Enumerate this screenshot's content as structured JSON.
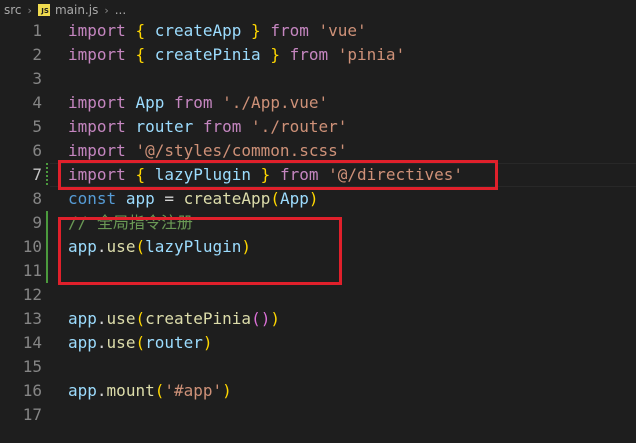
{
  "breadcrumb": {
    "folder": "src",
    "file_badge": "JS",
    "file": "main.js",
    "ellipsis": "..."
  },
  "editor": {
    "line_numbers": [
      "1",
      "2",
      "3",
      "4",
      "5",
      "6",
      "7",
      "8",
      "9",
      "10",
      "11",
      "12",
      "13",
      "14",
      "15",
      "16",
      "17"
    ],
    "active_line": "7",
    "lines": [
      [
        {
          "t": "import",
          "c": "kw2"
        },
        {
          "t": " ",
          "c": "plain"
        },
        {
          "t": "{",
          "c": "b1"
        },
        {
          "t": " createApp ",
          "c": "var"
        },
        {
          "t": "}",
          "c": "b1"
        },
        {
          "t": " ",
          "c": "plain"
        },
        {
          "t": "from",
          "c": "kw2"
        },
        {
          "t": " ",
          "c": "plain"
        },
        {
          "t": "'vue'",
          "c": "str"
        }
      ],
      [
        {
          "t": "import",
          "c": "kw2"
        },
        {
          "t": " ",
          "c": "plain"
        },
        {
          "t": "{",
          "c": "b1"
        },
        {
          "t": " createPinia ",
          "c": "var"
        },
        {
          "t": "}",
          "c": "b1"
        },
        {
          "t": " ",
          "c": "plain"
        },
        {
          "t": "from",
          "c": "kw2"
        },
        {
          "t": " ",
          "c": "plain"
        },
        {
          "t": "'pinia'",
          "c": "str"
        }
      ],
      [],
      [
        {
          "t": "import",
          "c": "kw2"
        },
        {
          "t": " ",
          "c": "plain"
        },
        {
          "t": "App",
          "c": "var"
        },
        {
          "t": " ",
          "c": "plain"
        },
        {
          "t": "from",
          "c": "kw2"
        },
        {
          "t": " ",
          "c": "plain"
        },
        {
          "t": "'./App.vue'",
          "c": "str"
        }
      ],
      [
        {
          "t": "import",
          "c": "kw2"
        },
        {
          "t": " ",
          "c": "plain"
        },
        {
          "t": "router",
          "c": "var"
        },
        {
          "t": " ",
          "c": "plain"
        },
        {
          "t": "from",
          "c": "kw2"
        },
        {
          "t": " ",
          "c": "plain"
        },
        {
          "t": "'./router'",
          "c": "str"
        }
      ],
      [
        {
          "t": "import",
          "c": "kw2"
        },
        {
          "t": " ",
          "c": "plain"
        },
        {
          "t": "'@/styles/common.scss'",
          "c": "str"
        }
      ],
      [
        {
          "t": "import",
          "c": "kw2"
        },
        {
          "t": " ",
          "c": "plain"
        },
        {
          "t": "{",
          "c": "b1"
        },
        {
          "t": " lazyPlugin ",
          "c": "var"
        },
        {
          "t": "}",
          "c": "b1"
        },
        {
          "t": " ",
          "c": "plain"
        },
        {
          "t": "from",
          "c": "kw2"
        },
        {
          "t": " ",
          "c": "plain"
        },
        {
          "t": "'@/directives'",
          "c": "str"
        }
      ],
      [
        {
          "t": "const",
          "c": "kw"
        },
        {
          "t": " ",
          "c": "plain"
        },
        {
          "t": "app",
          "c": "var"
        },
        {
          "t": " = ",
          "c": "plain"
        },
        {
          "t": "createApp",
          "c": "fn"
        },
        {
          "t": "(",
          "c": "b1"
        },
        {
          "t": "App",
          "c": "var"
        },
        {
          "t": ")",
          "c": "b1"
        }
      ],
      [
        {
          "t": "// 全局指令注册",
          "c": "cmt"
        }
      ],
      [
        {
          "t": "app",
          "c": "var"
        },
        {
          "t": ".",
          "c": "plain"
        },
        {
          "t": "use",
          "c": "fn"
        },
        {
          "t": "(",
          "c": "b1"
        },
        {
          "t": "lazyPlugin",
          "c": "var"
        },
        {
          "t": ")",
          "c": "b1"
        }
      ],
      [],
      [],
      [
        {
          "t": "app",
          "c": "var"
        },
        {
          "t": ".",
          "c": "plain"
        },
        {
          "t": "use",
          "c": "fn"
        },
        {
          "t": "(",
          "c": "b1"
        },
        {
          "t": "createPinia",
          "c": "fn"
        },
        {
          "t": "(",
          "c": "b2"
        },
        {
          "t": ")",
          "c": "b2"
        },
        {
          "t": ")",
          "c": "b1"
        }
      ],
      [
        {
          "t": "app",
          "c": "var"
        },
        {
          "t": ".",
          "c": "plain"
        },
        {
          "t": "use",
          "c": "fn"
        },
        {
          "t": "(",
          "c": "b1"
        },
        {
          "t": "router",
          "c": "var"
        },
        {
          "t": ")",
          "c": "b1"
        }
      ],
      [],
      [
        {
          "t": "app",
          "c": "var"
        },
        {
          "t": ".",
          "c": "plain"
        },
        {
          "t": "mount",
          "c": "fn"
        },
        {
          "t": "(",
          "c": "b1"
        },
        {
          "t": "'#app'",
          "c": "str"
        },
        {
          "t": ")",
          "c": "b1"
        }
      ],
      []
    ]
  },
  "colors": {
    "background": "#1e1e1e",
    "keyword_control": "#c586c0",
    "keyword": "#569cd6",
    "string": "#ce9178",
    "variable": "#9cdcfe",
    "function": "#dcdcaa",
    "comment": "#6a9955",
    "bracket_level1": "#ffd700",
    "bracket_level2": "#da70d6",
    "git_modified": "#4b9a3d",
    "annotation_box": "#e0202b"
  }
}
